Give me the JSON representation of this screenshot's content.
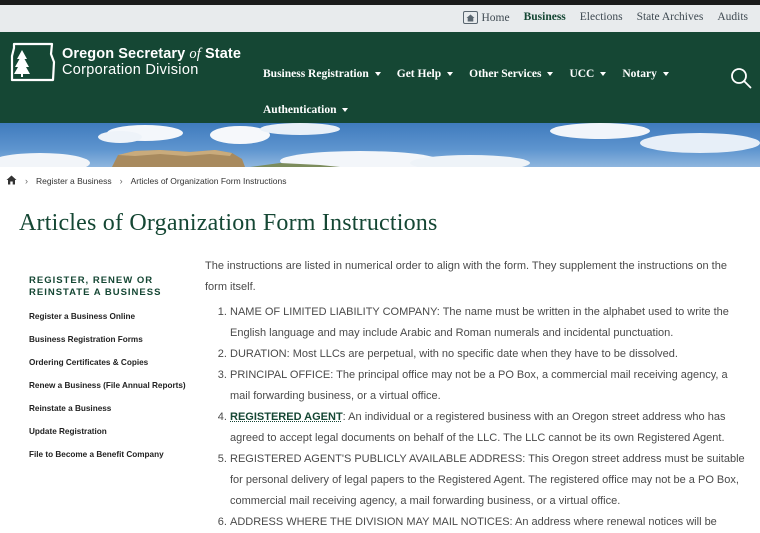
{
  "utility_nav": {
    "home": "Home",
    "business": "Business",
    "elections": "Elections",
    "state_archives": "State Archives",
    "audits": "Audits"
  },
  "logo": {
    "line1_part1": "Oregon Secretary ",
    "line1_italic": "of",
    "line1_part2": " State",
    "line2": "Corporation Division"
  },
  "main_nav": [
    {
      "label": "Business Registration"
    },
    {
      "label": "Get Help"
    },
    {
      "label": "Other Services"
    },
    {
      "label": "UCC"
    },
    {
      "label": "Notary"
    },
    {
      "label": "Authentication"
    }
  ],
  "breadcrumb": {
    "item1": "Register a Business",
    "item2": "Articles of Organization Form Instructions"
  },
  "page_title": "Articles of Organization Form Instructions",
  "sidebar": {
    "heading": "REGISTER, RENEW OR REINSTATE A BUSINESS",
    "items": [
      {
        "label": "Register a Business Online"
      },
      {
        "label": "Business Registration Forms"
      },
      {
        "label": "Ordering Certificates & Copies"
      },
      {
        "label": "Renew a Business (File Annual Reports)"
      },
      {
        "label": "Reinstate a Business"
      },
      {
        "label": "Update Registration"
      },
      {
        "label": "File to Become a Benefit Company"
      }
    ]
  },
  "content": {
    "intro": "The instructions are listed in numerical order to align with the form. They supplement the instructions on the form itself.",
    "items": [
      {
        "text": "NAME OF LIMITED LIABILITY COMPANY: The name must be written in the alphabet used to write the English language and may include Arabic and Roman numerals and incidental punctuation."
      },
      {
        "text": "DURATION: Most LLCs are perpetual, with no specific date when they have to be dissolved."
      },
      {
        "text": "PRINCIPAL OFFICE: The principal office may not be a PO Box, a commercial mail receiving agency, a mail forwarding business, or a virtual office."
      },
      {
        "link": "REGISTERED AGENT",
        "text": ": An individual or a registered business with an Oregon street address who has agreed to accept legal documents on behalf of the LLC. The LLC cannot be its own Registered Agent."
      },
      {
        "text": "REGISTERED AGENT'S PUBLICLY AVAILABLE ADDRESS: This Oregon street address must be suitable for personal delivery of legal papers to the Registered Agent. The registered office may not be a PO Box, commercial mail receiving agency, a mail forwarding business, or a virtual office."
      },
      {
        "text": "ADDRESS WHERE THE DIVISION MAY MAIL NOTICES: An address where renewal notices will be"
      }
    ]
  },
  "colors": {
    "brand_green": "#154734",
    "utility_bg": "#e8ebed"
  },
  "icons": {
    "home_util": "home-icon",
    "search": "search-icon",
    "breadcrumb_home": "home-icon",
    "chevron": "chevron-right-icon",
    "caret": "caret-down-icon"
  }
}
